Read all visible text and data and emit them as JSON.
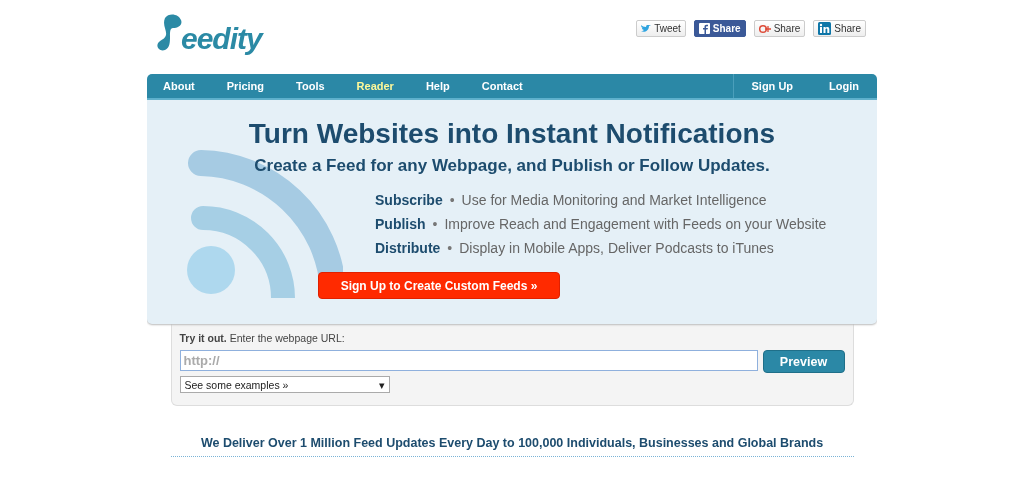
{
  "logo": {
    "text": "eedity"
  },
  "share_buttons": [
    {
      "kind": "twitter",
      "label": "Tweet"
    },
    {
      "kind": "facebook",
      "label": "Share"
    },
    {
      "kind": "googleplus",
      "label": "Share"
    },
    {
      "kind": "linkedin",
      "label": "Share"
    }
  ],
  "nav": {
    "items": [
      {
        "label": "About",
        "selected": false
      },
      {
        "label": "Pricing",
        "selected": false
      },
      {
        "label": "Tools",
        "selected": false
      },
      {
        "label": "Reader",
        "selected": true
      },
      {
        "label": "Help",
        "selected": false
      },
      {
        "label": "Contact",
        "selected": false
      }
    ],
    "right_items": [
      {
        "label": "Sign Up"
      },
      {
        "label": "Login"
      }
    ]
  },
  "hero": {
    "title": "Turn Websites into Instant Notifications",
    "subtitle": "Create a Feed for any Webpage, and Publish or Follow Updates.",
    "features": [
      {
        "name": "Subscribe",
        "text": "Use for Media Monitoring and Market Intelligence"
      },
      {
        "name": "Publish",
        "text": "Improve Reach and Engagement with Feeds on your Website"
      },
      {
        "name": "Distribute",
        "text": "Display in Mobile Apps, Deliver Podcasts to iTunes"
      }
    ],
    "separator": "•",
    "cta": "Sign Up to Create Custom Feeds »"
  },
  "try_it": {
    "intro": "**Try it out.** Enter the webpage URL:",
    "placeholder": "http://",
    "button": "Preview",
    "examples": "See some examples »",
    "examples_caret": "▾"
  },
  "tagline": "We Deliver Over 1 Million Feed Updates Every Day to 100,000 Individuals, Businesses and Global Brands"
}
